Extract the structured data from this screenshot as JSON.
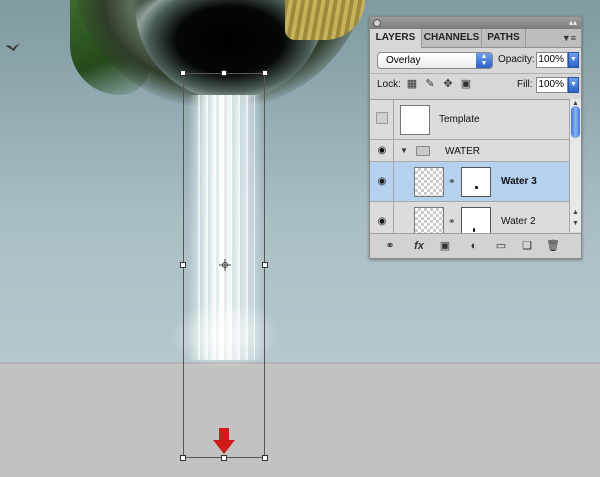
{
  "canvas": {
    "colors": {
      "sky": "#93abb2",
      "floor": "#c2c2c2",
      "arrow": "#d11a1a"
    },
    "icons": [
      "bird-icon",
      "crosshair-icon",
      "down-arrow-icon"
    ]
  },
  "layers_panel": {
    "tabs": [
      {
        "label": "LAYERS",
        "active": true
      },
      {
        "label": "CHANNELS",
        "active": false
      },
      {
        "label": "PATHS",
        "active": false
      }
    ],
    "blend_mode": "Overlay",
    "opacity_label": "Opacity:",
    "opacity_value": "100%",
    "lock_label": "Lock:",
    "fill_label": "Fill:",
    "fill_value": "100%",
    "layers": [
      {
        "name": "Template",
        "visible": false,
        "selected": false,
        "has_mask": false
      },
      {
        "name": "WATER",
        "type": "group",
        "visible": true,
        "expanded": true
      },
      {
        "name": "Water 3",
        "visible": true,
        "selected": true,
        "has_mask": true
      },
      {
        "name": "Water 2",
        "visible": true,
        "selected": false,
        "has_mask": true
      }
    ],
    "footer_icons": [
      "link-layers-icon",
      "fx-icon",
      "add-mask-icon",
      "adjustment-layer-icon",
      "new-group-icon",
      "new-layer-icon",
      "trash-icon"
    ],
    "colors": {
      "selected_row": "#b6d0f0",
      "accent": "#2a62c8"
    }
  }
}
